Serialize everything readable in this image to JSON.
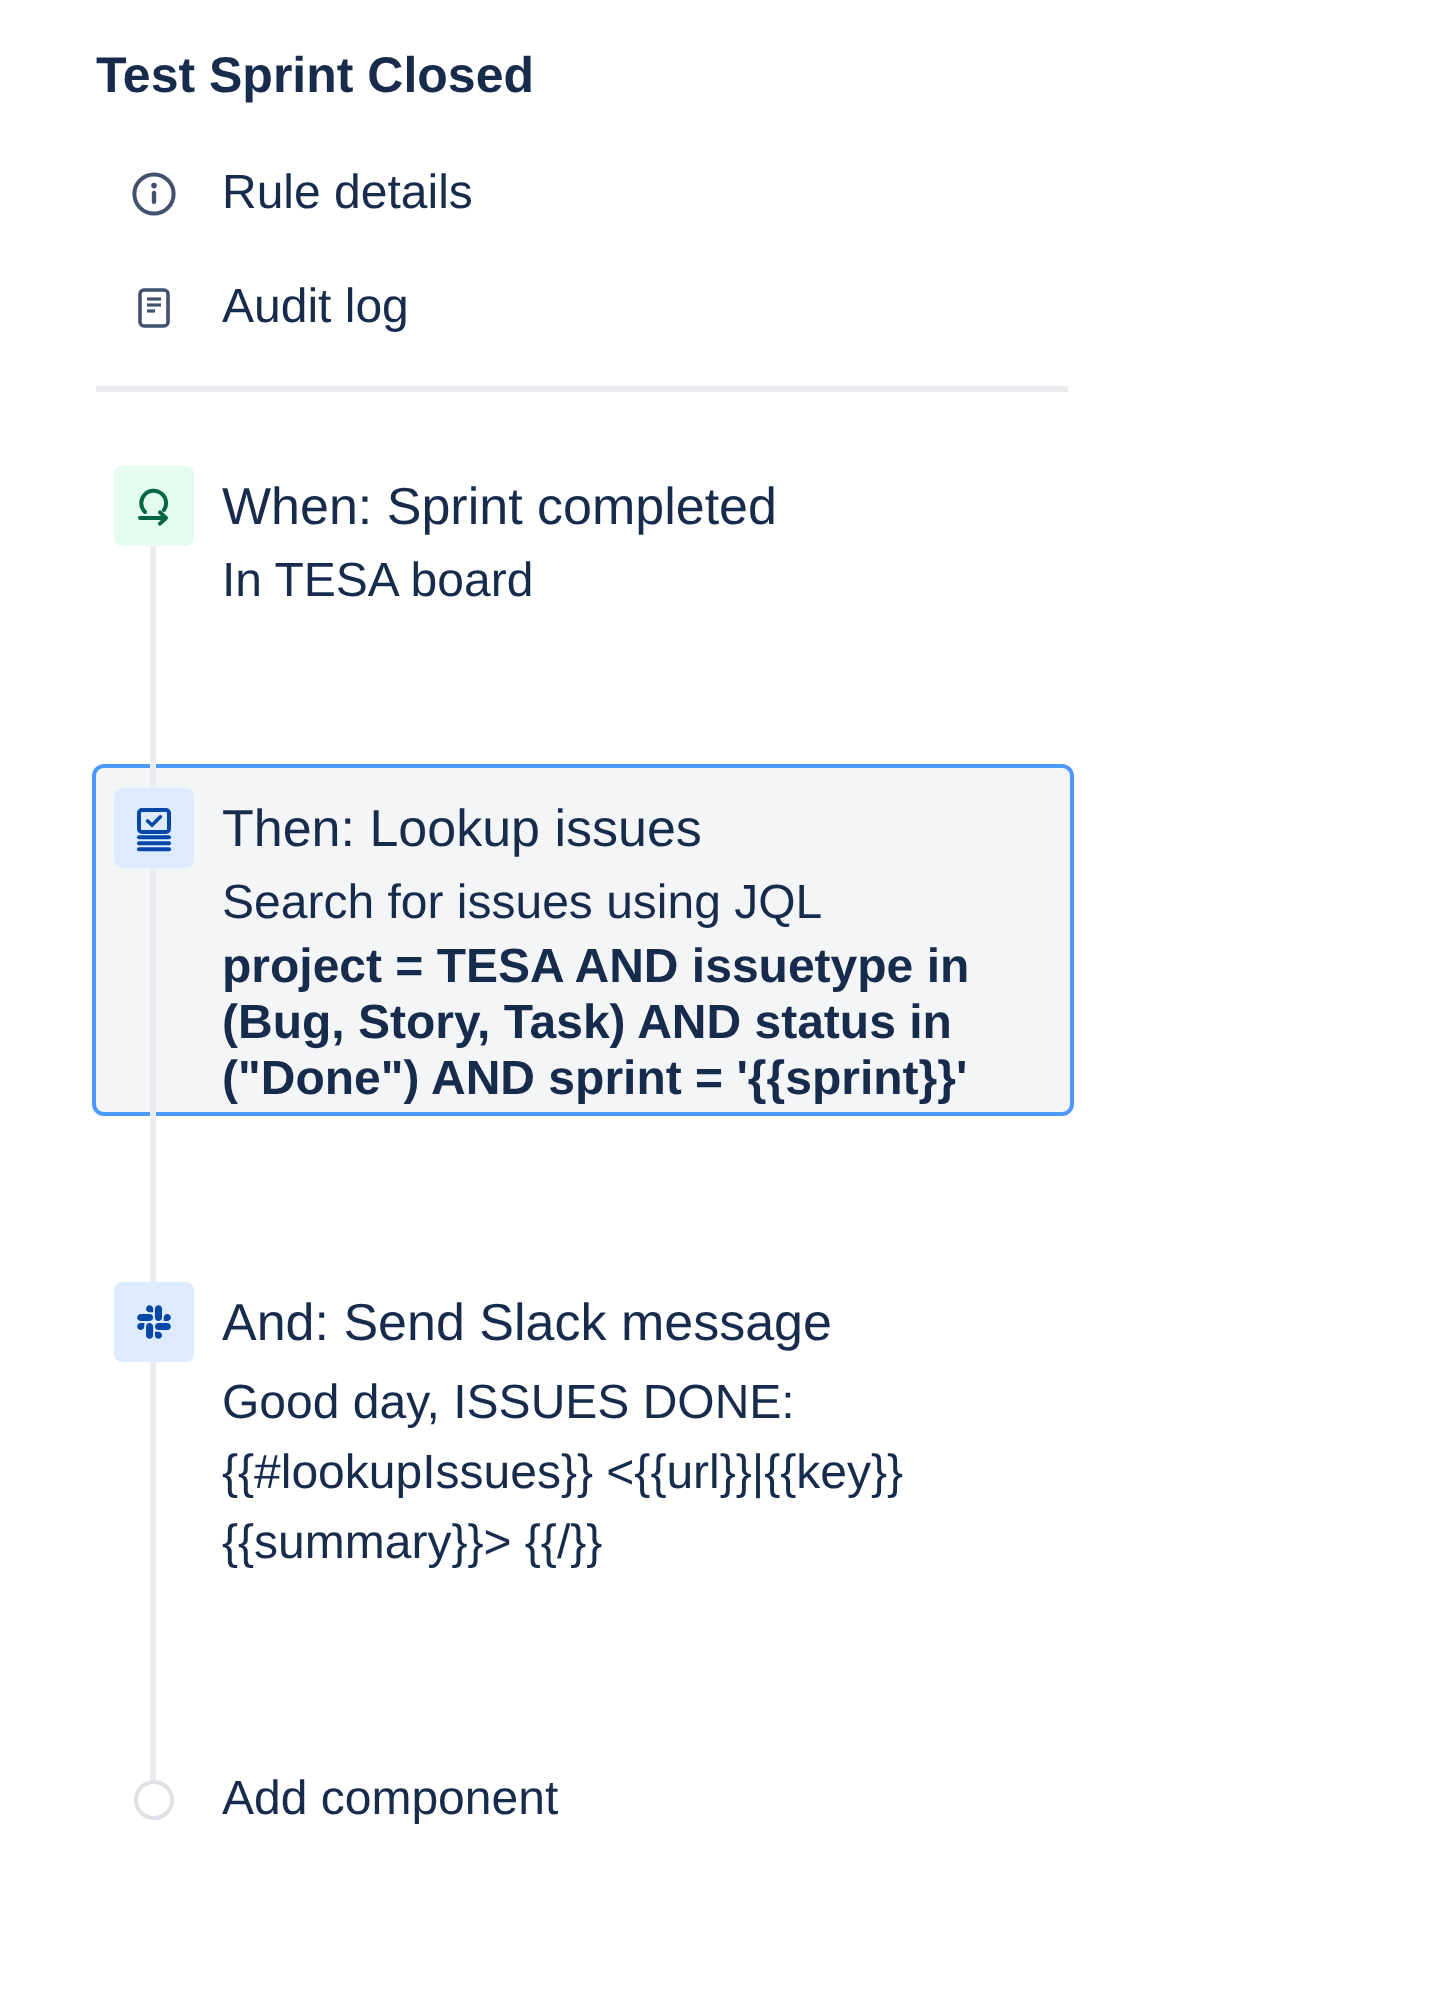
{
  "rule": {
    "title": "Test Sprint Closed"
  },
  "nav": [
    {
      "kind": "info",
      "label": "Rule details"
    },
    {
      "kind": "log",
      "label": "Audit log"
    }
  ],
  "components": [
    {
      "kind": "trigger",
      "selected": false,
      "title": "When: Sprint completed",
      "description": "In TESA board"
    },
    {
      "kind": "lookup",
      "selected": true,
      "title": "Then: Lookup issues",
      "description": "Search for issues using JQL",
      "query": "project = TESA AND issuetype in (Bug, Story, Task) AND status in (\"Done\") AND sprint = '{{sprint}}'"
    },
    {
      "kind": "slack",
      "selected": false,
      "title": "And: Send Slack message",
      "message": "Good day, ISSUES DONE: {{#lookupIssues}} <{{url}}|{{key}} {{summary}}> {{/}}"
    }
  ],
  "add_component": {
    "label": "Add component"
  }
}
